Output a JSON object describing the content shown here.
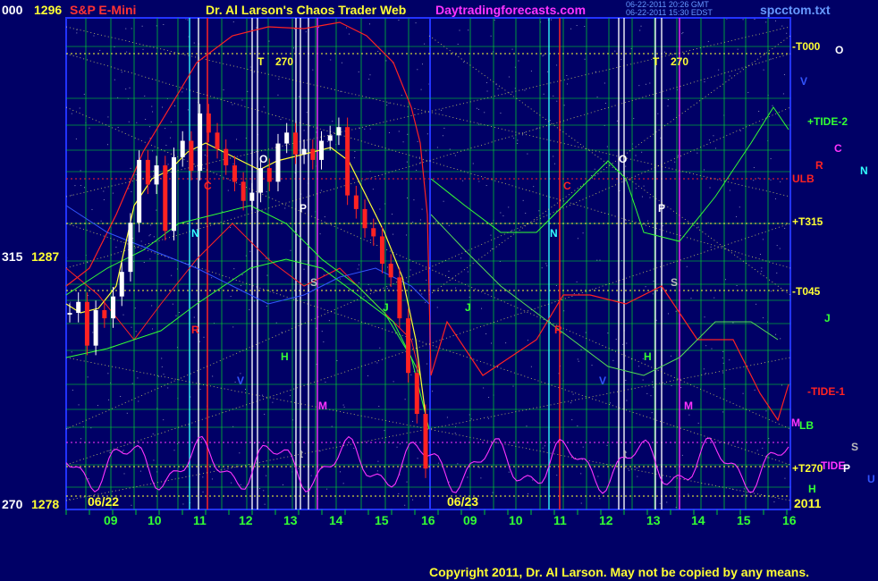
{
  "header": {
    "left_code": "000",
    "left_price": "1296",
    "symbol": "S&P E-Mini",
    "title": "Dr. Al Larson's Chaos Trader Web",
    "site": "Daytradingforecasts.com",
    "stamp1": "06-22-2011 20:26 GMT",
    "stamp2": "06-22-2011 15:30 EDST",
    "file": "spcctom.txt"
  },
  "y_labels": [
    {
      "code": "315",
      "price": "1287"
    },
    {
      "code": "270",
      "price": "1278"
    }
  ],
  "dates": [
    "06/22",
    "06/23"
  ],
  "year": "2011",
  "copyright": "Copyright 2011, Dr. Al Larson.  May not be copied by any means.",
  "right_labels": [
    "-T000",
    "+TIDE-2",
    "ULB",
    "+T315",
    "-T045",
    "-TIDE-1",
    "LB",
    "+T270",
    "TIDE"
  ],
  "planet_right": [
    "O",
    "V",
    "C",
    "R",
    "N",
    "J",
    "M",
    "S",
    "P",
    "U",
    "H"
  ],
  "in_chart_labels": [
    "T",
    "270",
    "O",
    "C",
    "P",
    "N",
    "S",
    "R",
    "J",
    "V",
    "H",
    "M",
    "t"
  ],
  "colors": {
    "bg": "#000066",
    "grid": "#00cc33",
    "yellow": "#ffff33",
    "red": "#ff2222",
    "white": "#ffffff",
    "magenta": "#ff33ff",
    "green": "#33ff33",
    "cyan": "#33ffff",
    "blue": "#2222ff",
    "gray": "#bbbbbb"
  },
  "chart_data": {
    "type": "line",
    "x_ticks": [
      "09",
      "10",
      "11",
      "12",
      "13",
      "14",
      "15",
      "16",
      "09",
      "10",
      "11",
      "12",
      "13",
      "14",
      "15",
      "16"
    ],
    "y_ticks": [
      1296,
      1287,
      1278
    ],
    "ylim": [
      1278,
      1296
    ],
    "price_series": [
      {
        "name": "06/22",
        "close": [
          1285.2,
          1285.6,
          1284.0,
          1285.3,
          1285.0,
          1285.8,
          1286.7,
          1288.5,
          1290.8,
          1289.9,
          1290.6,
          1288.2,
          1290.9,
          1291.5,
          1290.4,
          1292.5,
          1291.8,
          1291.2,
          1290.6,
          1290.0,
          1289.3,
          1289.6,
          1290.5,
          1290.0,
          1291.4,
          1291.8,
          1291.0,
          1291.2,
          1290.8,
          1291.5,
          1291.7,
          1292.0,
          1289.5,
          1289.0,
          1288.3,
          1288.0,
          1287.0,
          1286.5,
          1285.0,
          1283.0,
          1281.5,
          1279.5
        ]
      },
      {
        "name": "06/23",
        "close": []
      }
    ]
  }
}
